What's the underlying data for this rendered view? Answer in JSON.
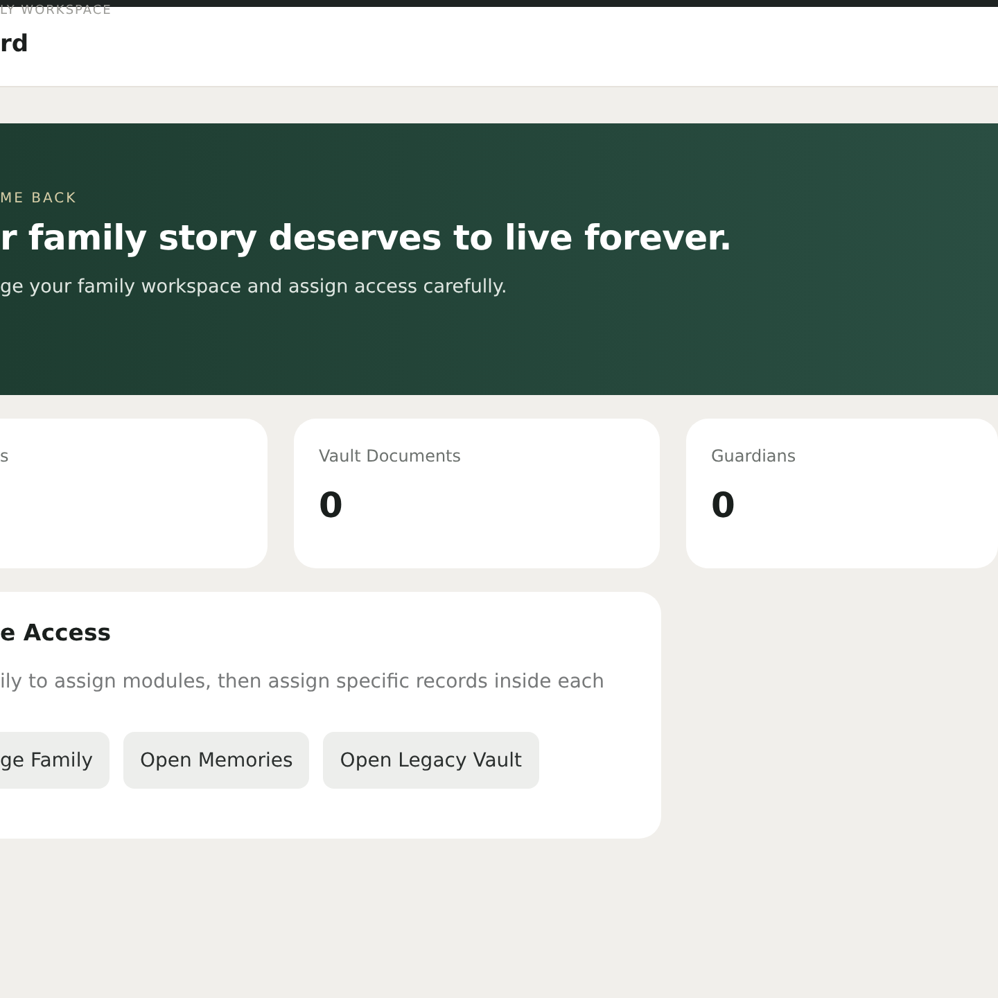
{
  "header": {
    "eyebrow": "LY WORKSPACE",
    "title": "rd"
  },
  "hero": {
    "eyebrow": "ME BACK",
    "title": "r family story deserves to live forever.",
    "subtitle": "ge your family workspace and assign access carefully."
  },
  "stats": [
    {
      "label": "s"
    },
    {
      "label": "Vault Documents",
      "value": "0"
    },
    {
      "label": "Guardians",
      "value": "0"
    }
  ],
  "access_card": {
    "title": "e Access",
    "text": "ily to assign modules, then assign specific records inside each",
    "buttons": [
      "ge Family",
      "Open Memories",
      "Open Legacy Vault"
    ]
  }
}
